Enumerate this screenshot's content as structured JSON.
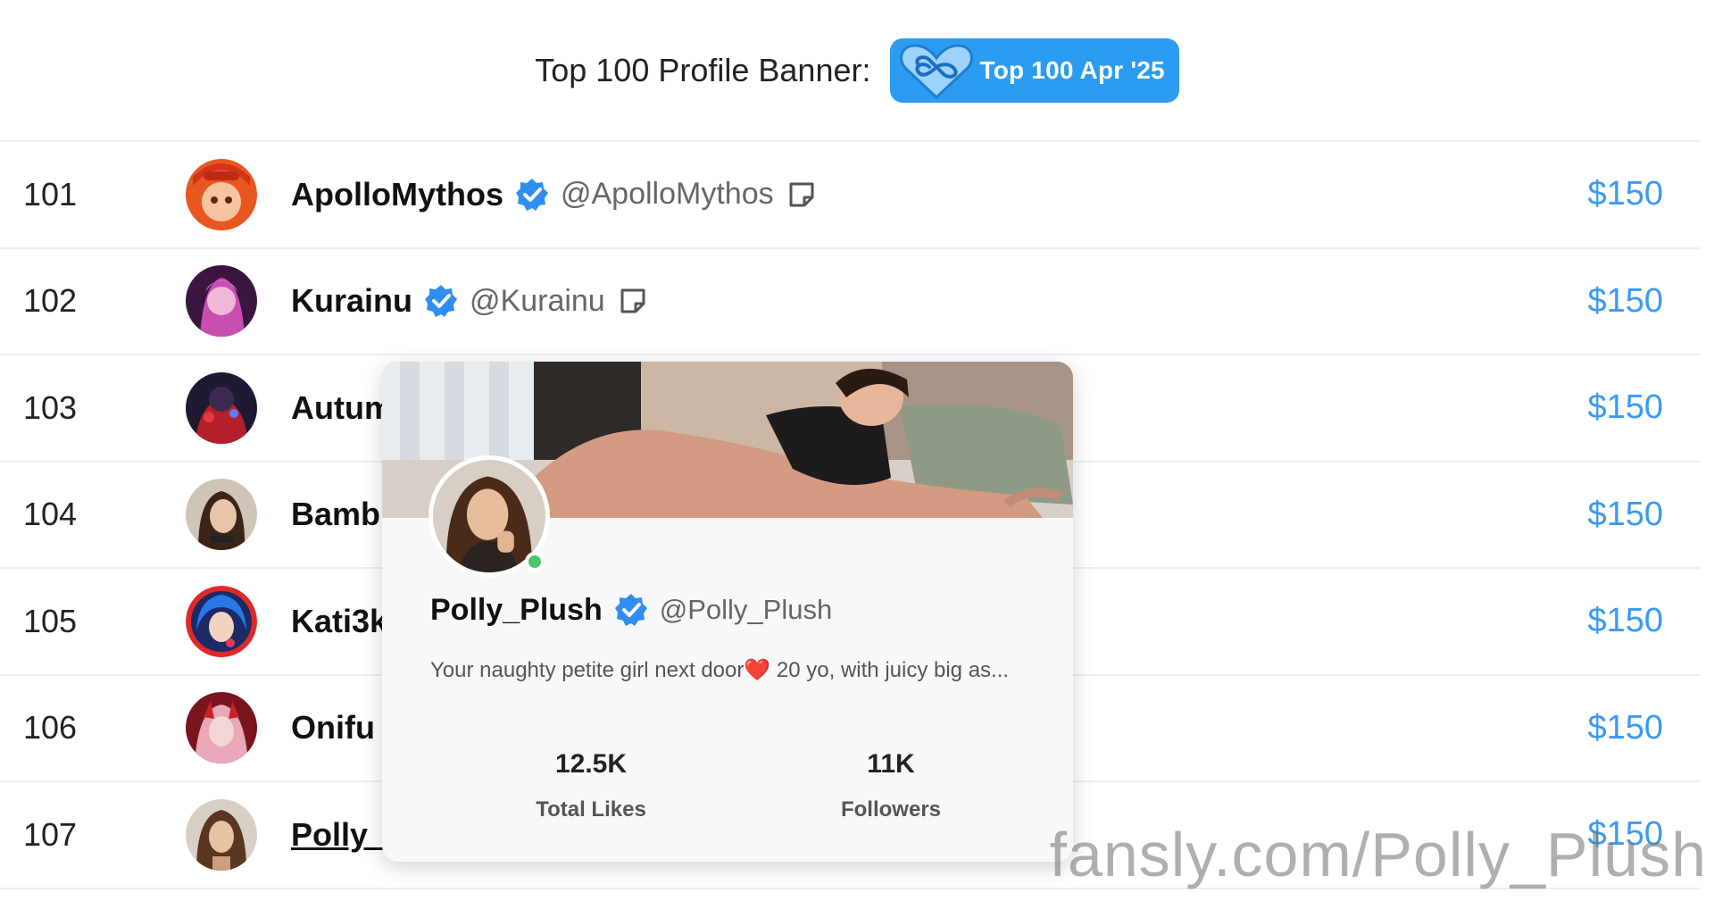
{
  "banner": {
    "label": "Top 100 Profile Banner:",
    "badge_text": "Top 100 Apr '25",
    "badge_color": "#2c9cf0",
    "badge_icon": "infinity-heart-icon"
  },
  "rows": [
    {
      "rank": "101",
      "name": "ApolloMythos",
      "handle": "@ApolloMythos",
      "price": "$150",
      "verified": true,
      "note_icon": true
    },
    {
      "rank": "102",
      "name": "Kurainu",
      "handle": "@Kurainu",
      "price": "$150",
      "verified": true,
      "note_icon": true
    },
    {
      "rank": "103",
      "name": "Autum",
      "price": "$150"
    },
    {
      "rank": "104",
      "name": "Bamb",
      "price": "$150"
    },
    {
      "rank": "105",
      "name": "Kati3k",
      "price": "$150"
    },
    {
      "rank": "106",
      "name": "Onifu",
      "price": "$150"
    },
    {
      "rank": "107",
      "name": "Polly_",
      "price": "$150"
    }
  ],
  "hover_card": {
    "name": "Polly_Plush",
    "handle": "@Polly_Plush",
    "bio": "Your naughty petite girl next door",
    "bio_emoji": "❤️",
    "bio_cont": " 20 yo, with juicy big as...",
    "stats": [
      {
        "value": "12.5K",
        "label": "Total Likes"
      },
      {
        "value": "11K",
        "label": "Followers"
      }
    ],
    "online": true
  },
  "watermark": "fansly.com/Polly_Plush",
  "colors": {
    "accent": "#3b99f5",
    "verified": "#2f8ef0",
    "online": "#4cc56a"
  }
}
